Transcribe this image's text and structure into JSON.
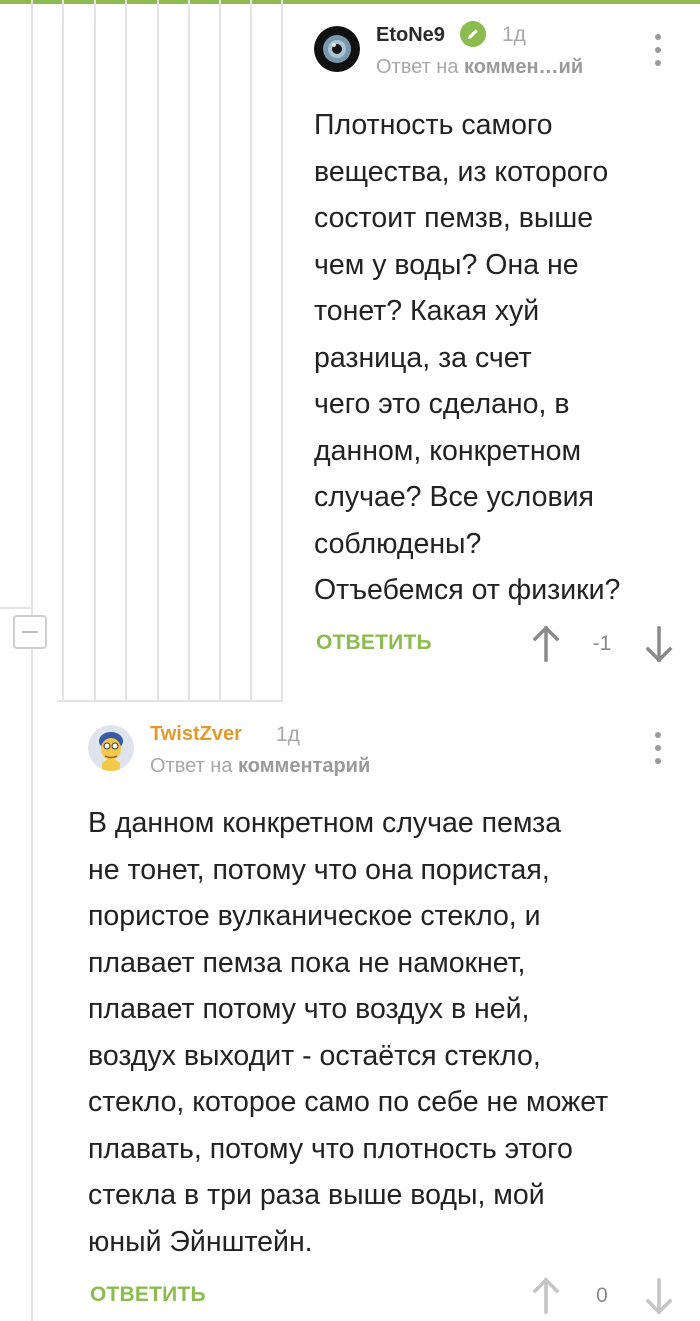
{
  "thread": {
    "collapse_label": "−"
  },
  "comments": [
    {
      "author": "EtoNe9",
      "author_color": "#2b2b2b",
      "verified_icon": "pencil-icon",
      "time": "1д",
      "reply_prefix": "Ответ на",
      "reply_target": "коммен…ий",
      "body_lines": [
        "Плотность самого",
        "вещества, из которого",
        "состоит пемзв, выше",
        "чем у воды? Она не",
        "тонет? Какая хуй",
        "разница, за счет",
        "чего это сделано, в",
        "данном, конкретном",
        "случае? Все условия",
        "соблюдены?",
        "Отъебемся от физики?"
      ],
      "reply_button": "ОТВЕТИТЬ",
      "rating": "-1",
      "upvote_icon": "arrow-up-icon",
      "downvote_icon": "arrow-down-icon",
      "menu_icon": "more-vertical-icon"
    },
    {
      "author": "TwistZver",
      "author_color": "#e39a2b",
      "time": "1д",
      "reply_prefix": "Ответ на",
      "reply_target": "комментарий",
      "body_lines": [
        "В данном конкретном случае пемза",
        "не тонет, потому что она пористая,",
        "пористое вулканическое стекло, и",
        "плавает пемза пока не намокнет,",
        "плавает потому что воздух в ней,",
        "воздух выходит - остаётся стекло,",
        "стекло, которое само по себе не может",
        "плавать, потому что плотность этого",
        "стекла в три раза выше воды, мой",
        "юный Эйнштейн."
      ],
      "reply_button": "ОТВЕТИТЬ",
      "rating": "0",
      "upvote_icon": "arrow-up-icon",
      "downvote_icon": "arrow-down-icon",
      "menu_icon": "more-vertical-icon"
    }
  ],
  "colors": {
    "accent": "#8cbc4f",
    "thread_line": "#e3e3e3",
    "muted_text": "#a8a8a8"
  }
}
